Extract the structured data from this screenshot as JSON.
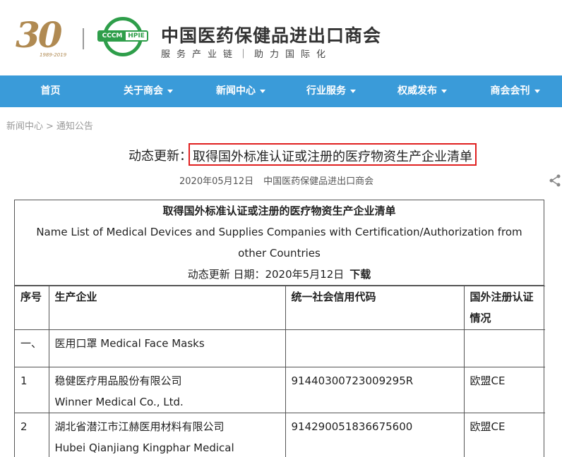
{
  "header": {
    "anniv_number": "30",
    "anniv_years": "1989-2019",
    "logo_left": "CCCM",
    "logo_right": "HPIE",
    "org_name": "中国医药保健品进出口商会",
    "slogan": "服务产业链｜助力国际化"
  },
  "nav": [
    {
      "label": "首页",
      "dropdown": false
    },
    {
      "label": "关于商会",
      "dropdown": true
    },
    {
      "label": "新闻中心",
      "dropdown": true
    },
    {
      "label": "行业服务",
      "dropdown": true
    },
    {
      "label": "权威发布",
      "dropdown": true
    },
    {
      "label": "商会会刊",
      "dropdown": true
    }
  ],
  "breadcrumb": {
    "first": "新闻中心",
    "separator": ">",
    "second": "通知公告"
  },
  "article": {
    "title_prefix": "动态更新：",
    "title_main": "取得国外标准认证或注册的医疗物资生产企业清单",
    "date": "2020年05月12日",
    "source": "中国医药保健品进出口商会"
  },
  "doc": {
    "title_cn": "取得国外标准认证或注册的医疗物资生产企业清单",
    "title_en": "Name List of Medical Devices and Supplies Companies with Certification/Authorization from other Countries",
    "date_line": "动态更新 日期：2020年5月12日",
    "download": "下载",
    "columns": [
      "序号",
      "生产企业",
      "统一社会信用代码",
      "国外注册认证情况"
    ],
    "section": {
      "index": "一、",
      "name": "医用口罩 Medical Face Masks"
    },
    "rows": [
      {
        "index": "1",
        "name_cn": "稳健医疗用品股份有限公司",
        "name_en": "Winner Medical Co., Ltd.",
        "code": "91440300723009295R",
        "cert": "欧盟CE"
      },
      {
        "index": "2",
        "name_cn": "湖北省潜江市江赫医用材料有限公司",
        "name_en": "Hubei Qianjiang Kingphar Medical",
        "code": "914290051836675600",
        "cert": "欧盟CE"
      }
    ]
  },
  "colors": {
    "nav_bg": "#3a9bd9",
    "highlight_border": "#e02020",
    "logo_green": "#2e9e4a",
    "logo_gold": "#b08a52"
  }
}
